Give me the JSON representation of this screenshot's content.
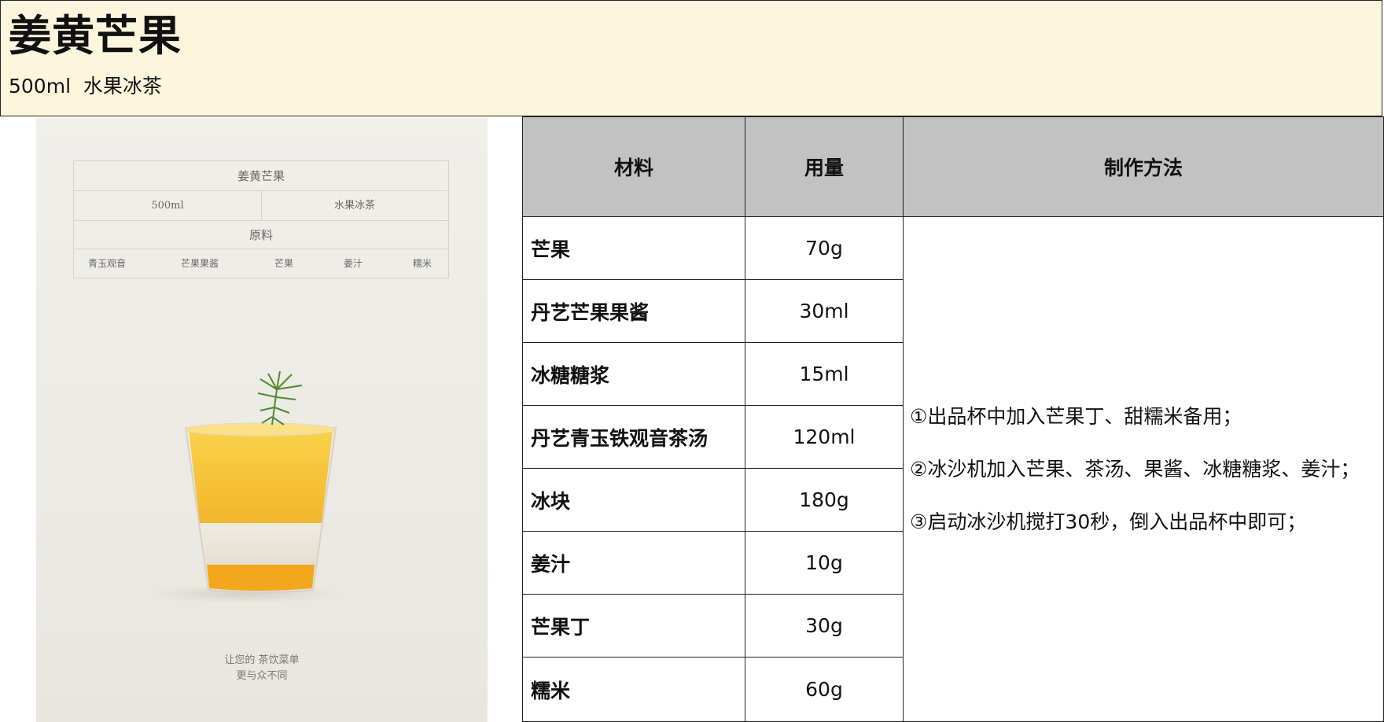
{
  "header": {
    "title": "姜黄芒果",
    "subtitle": "500ml  水果冰茶"
  },
  "poster": {
    "card_title": "姜黄芒果",
    "card_size": "500ml",
    "card_category": "水果冰茶",
    "card_raw_label": "原料",
    "card_ingredients": [
      "青玉观音",
      "芒果果酱",
      "芒果",
      "姜汁",
      "糯米"
    ],
    "slogan_line1": "让您的  茶饮菜单",
    "slogan_line2": "更与众不同",
    "colors": {
      "drink_top": "#f6c63a",
      "drink_bottom": "#f2a71e",
      "rice": "#ece5d6",
      "leaf": "#4f8a2b"
    }
  },
  "table": {
    "headers": [
      "材料",
      "用量",
      "制作方法"
    ],
    "rows": [
      {
        "name": "芒果",
        "qty": "70g"
      },
      {
        "name": "丹艺芒果果酱",
        "qty": "30ml"
      },
      {
        "name": "冰糖糖浆",
        "qty": "15ml"
      },
      {
        "name": "丹艺青玉铁观音茶汤",
        "qty": "120ml"
      },
      {
        "name": "冰块",
        "qty": "180g"
      },
      {
        "name": "姜汁",
        "qty": "10g"
      },
      {
        "name": "芒果丁",
        "qty": "30g"
      },
      {
        "name": "糯米",
        "qty": "60g"
      }
    ],
    "method": [
      "①出品杯中加入芒果丁、甜糯米备用；",
      "②冰沙机加入芒果、茶汤、果酱、冰糖糖浆、姜汁；",
      "③启动冰沙机搅打30秒，倒入出品杯中即可；"
    ]
  },
  "colors": {
    "header_bg": "#fdf6dd",
    "table_header_bg": "#c2c2c2",
    "border": "#222222"
  }
}
